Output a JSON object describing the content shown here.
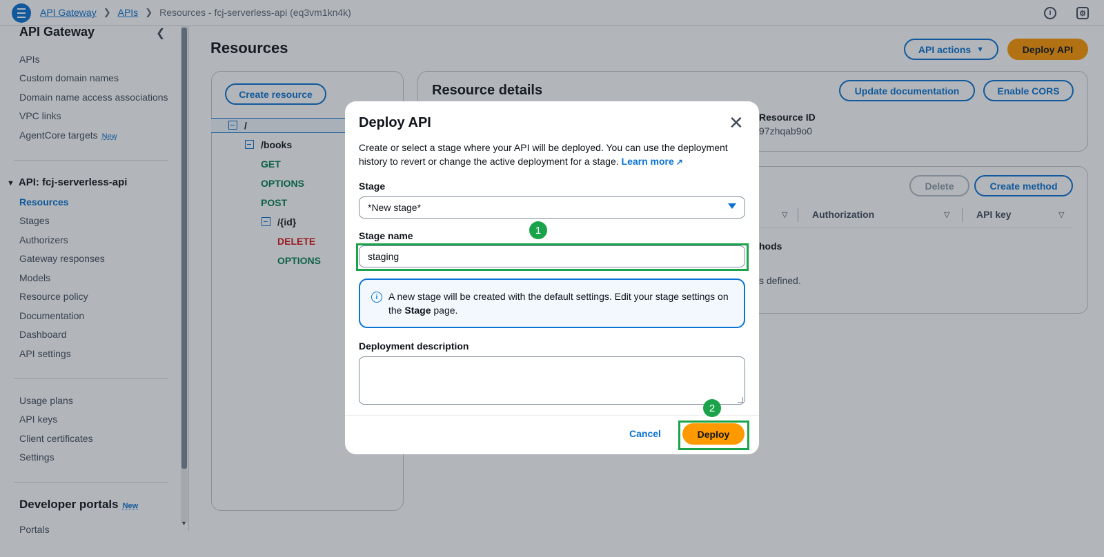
{
  "topbar": {
    "breadcrumbs": [
      "API Gateway",
      "APIs",
      "Resources - fcj-serverless-api (eq3vm1kn4k)"
    ],
    "info_icon": "info-icon",
    "settings_icon": "settings-icon"
  },
  "sidebar": {
    "title": "API Gateway",
    "items": [
      "APIs",
      "Custom domain names",
      "Domain name access associations",
      "VPC links",
      "AgentCore targets"
    ],
    "new_badge": "New",
    "api_section": "API: fcj-serverless-api",
    "api_items": [
      "Resources",
      "Stages",
      "Authorizers",
      "Gateway responses",
      "Models",
      "Resource policy",
      "Documentation",
      "Dashboard",
      "API settings"
    ],
    "bottom_items": [
      "Usage plans",
      "API keys",
      "Client certificates",
      "Settings"
    ],
    "developer_portals": "Developer portals",
    "developer_new": "New",
    "cut_item": "Portals"
  },
  "main": {
    "title": "Resources",
    "api_actions": "API actions",
    "deploy_api": "Deploy API",
    "create_resource": "Create resource",
    "tree": [
      {
        "label": "/",
        "kind": "path"
      },
      {
        "label": "/books",
        "kind": "path"
      },
      {
        "label": "GET",
        "kind": "get"
      },
      {
        "label": "OPTIONS",
        "kind": "options"
      },
      {
        "label": "POST",
        "kind": "post"
      },
      {
        "label": "/{id}",
        "kind": "path"
      },
      {
        "label": "DELETE",
        "kind": "delete"
      },
      {
        "label": "OPTIONS",
        "kind": "options"
      }
    ],
    "resource_details_title": "Resource details",
    "update_documentation": "Update documentation",
    "enable_cors": "Enable CORS",
    "resource_id_label": "Resource ID",
    "resource_id_value": "97zhqab9o0",
    "delete": "Delete",
    "create_method": "Create method",
    "col_authorization": "Authorization",
    "col_api_key": "API key",
    "methods_fragment": "hods",
    "defined_fragment": "s defined."
  },
  "modal": {
    "title": "Deploy API",
    "description": "Create or select a stage where your API will be deployed. You can use the deployment history to revert or change the active deployment for a stage.",
    "learn_more": "Learn more",
    "stage_label": "Stage",
    "stage_value": "*New stage*",
    "stage_name_label": "Stage name",
    "stage_name_value": "staging",
    "info_text_1": "A new stage will be created with the default settings. Edit your stage settings on the ",
    "info_bold": "Stage",
    "info_text_2": " page.",
    "deployment_description_label": "Deployment description",
    "deployment_description_value": "",
    "cancel": "Cancel",
    "deploy": "Deploy",
    "marker_1": "1",
    "marker_2": "2"
  }
}
